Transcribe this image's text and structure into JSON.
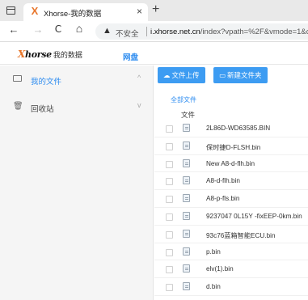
{
  "browser": {
    "tab_title": "Xhorse-我的数据",
    "tab_close": "×",
    "new_tab": "+",
    "favicon": "X",
    "back": "←",
    "forward": "→",
    "reload": "C",
    "home": "⌂",
    "warning_icon": "▲",
    "insecure_label": "不安全",
    "url_host": "i.xhorse.net.cn",
    "url_path": "/index?vpath=%2F&vmode=1&code"
  },
  "header": {
    "logo_prefix": "X",
    "logo_rest": "horse",
    "logo_cn": "我的数据",
    "nav_item": "网盘"
  },
  "sidebar": {
    "items": [
      {
        "label": "我的文件",
        "icon": "folder-icon",
        "chevron": "^",
        "active": true
      },
      {
        "label": "回收站",
        "icon": "trash-icon",
        "chevron": "v",
        "active": false
      }
    ]
  },
  "toolbar": {
    "upload_label": "文件上传",
    "upload_icon": "☁",
    "new_folder_label": "新建文件夹",
    "new_folder_icon": "▭"
  },
  "breadcrumb": "全部文件",
  "table": {
    "header": "文件",
    "files": [
      "2L86D-WD63585.BIN",
      "保时捷D-FLSH.bin",
      "New A8-d-flh.bin",
      "A8-d-flh.bin",
      "A8-p-fls.bin",
      "9237047 0L15Y -fixEEP-0km.bin",
      "93c76蓝箱智能ECU.bin",
      "p.bin",
      "elv(1).bin",
      "d.bin"
    ]
  },
  "colors": {
    "accent": "#2d8cf0",
    "button": "#3d9cf2",
    "brand_orange": "#e8762b"
  }
}
